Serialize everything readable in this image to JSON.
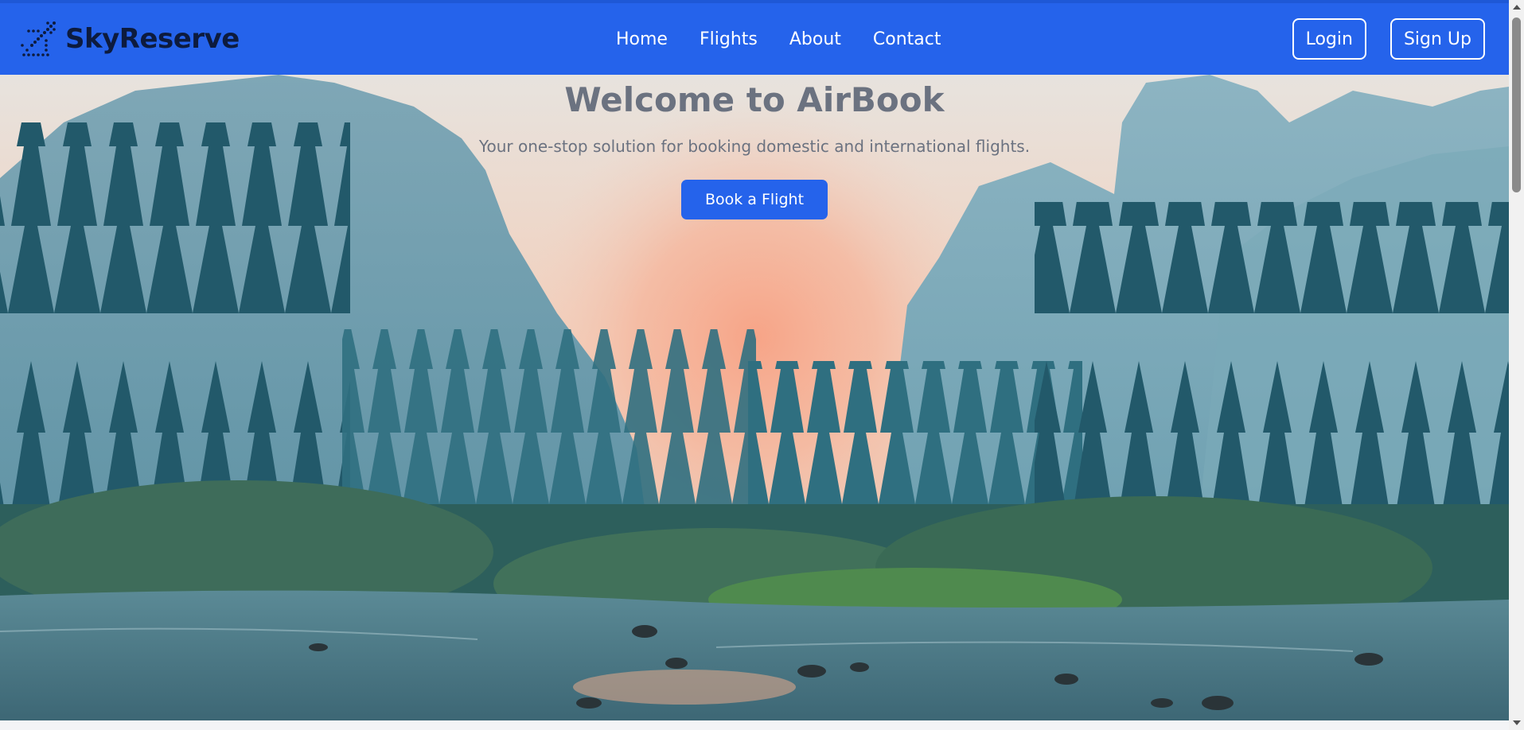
{
  "brand": {
    "name": "SkyReserve",
    "icon": "airplane-takeoff-icon"
  },
  "nav": {
    "links": [
      "Home",
      "Flights",
      "About",
      "Contact"
    ]
  },
  "auth": {
    "login_label": "Login",
    "signup_label": "Sign Up"
  },
  "hero": {
    "title": "Welcome to AirBook",
    "subtitle": "Your one-stop solution for booking domestic and international flights.",
    "cta_label": "Book a Flight",
    "background": "mountain valley forest river at sunrise"
  },
  "colors": {
    "primary": "#2563eb",
    "brand_text": "#0d1b3e",
    "hero_text": "#6b7280"
  }
}
